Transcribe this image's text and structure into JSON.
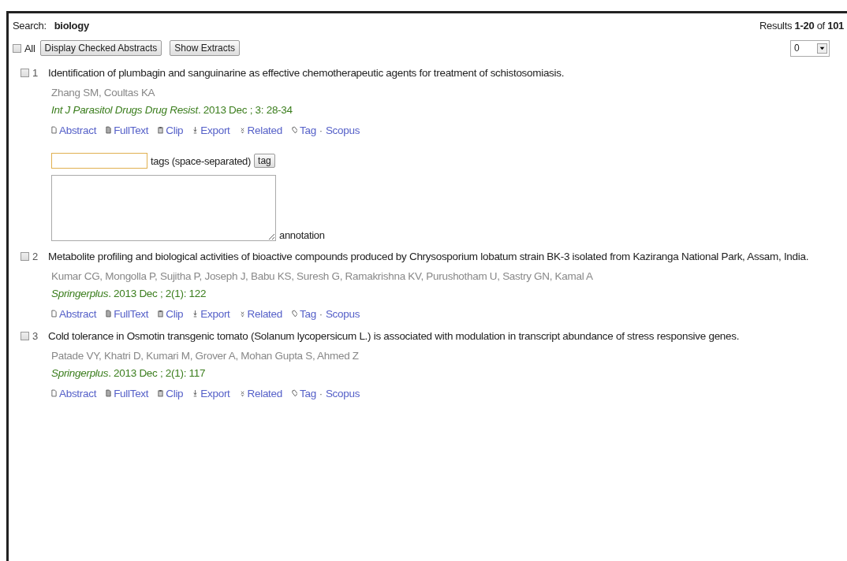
{
  "search": {
    "label": "Search:",
    "query": "biology"
  },
  "results": "Results **1-20** of **101**",
  "toolbar": {
    "all_checkbox": {
      "label": "All",
      "checked": false
    },
    "buttons": [
      "Display Checked Abstracts",
      "Show Extracts"
    ],
    "page_select": {
      "value": "0"
    }
  },
  "items": [
    {
      "number": "1",
      "checked": false,
      "title": "Identification of plumbagin and sanguinarine as effective chemotherapeutic agents for treatment of schistosomiasis.",
      "authors": "Zhang SM, Coultas KA",
      "journal": "Int J Parasitol Drugs Drug Resist",
      "citation": ". 2013 Dec ; 3: 28-34",
      "links": [
        {
          "kind": "abstract",
          "label": "Abstract"
        },
        {
          "kind": "fulltext",
          "label": "FullText"
        },
        {
          "kind": "clip",
          "label": "Clip"
        },
        {
          "kind": "export",
          "label": "Export"
        },
        {
          "kind": "related",
          "label": "Related"
        },
        {
          "kind": "tag",
          "label": "Tag"
        }
      ],
      "separator": "·",
      "extra_link": "Scopus",
      "tag_form": {
        "focused": true,
        "hint": "tags (space-separated)",
        "button": "tag",
        "annotation_label": "annotation"
      }
    },
    {
      "number": "2",
      "checked": false,
      "title": "Metabolite profiling and biological activities of bioactive compounds produced by Chrysosporium lobatum strain BK-3 isolated from Kaziranga National Park, Assam, India.",
      "authors": "Kumar CG, Mongolla P, Sujitha P, Joseph J, Babu KS, Suresh G, Ramakrishna KV, Purushotham U, Sastry GN, Kamal A",
      "journal": "Springerplus",
      "citation": ". 2013 Dec ; 2(1): 122",
      "links": [
        {
          "kind": "abstract",
          "label": "Abstract"
        },
        {
          "kind": "fulltext",
          "label": "FullText"
        },
        {
          "kind": "clip",
          "label": "Clip"
        },
        {
          "kind": "export",
          "label": "Export"
        },
        {
          "kind": "related",
          "label": "Related"
        },
        {
          "kind": "tag",
          "label": "Tag"
        }
      ],
      "separator": "·",
      "extra_link": "Scopus"
    },
    {
      "number": "3",
      "checked": false,
      "title": "Cold tolerance in Osmotin transgenic tomato (Solanum lycopersicum L.) is associated with modulation in transcript abundance of stress responsive genes.",
      "authors": "Patade VY, Khatri D, Kumari M, Grover A, Mohan Gupta S, Ahmed Z",
      "journal": "Springerplus",
      "citation": ". 2013 Dec ; 2(1): 117",
      "links": [
        {
          "kind": "abstract",
          "label": "Abstract"
        },
        {
          "kind": "fulltext",
          "label": "FullText"
        },
        {
          "kind": "clip",
          "label": "Clip"
        },
        {
          "kind": "export",
          "label": "Export"
        },
        {
          "kind": "related",
          "label": "Related"
        },
        {
          "kind": "tag",
          "label": "Tag"
        }
      ],
      "separator": "·",
      "extra_link": "Scopus"
    }
  ]
}
